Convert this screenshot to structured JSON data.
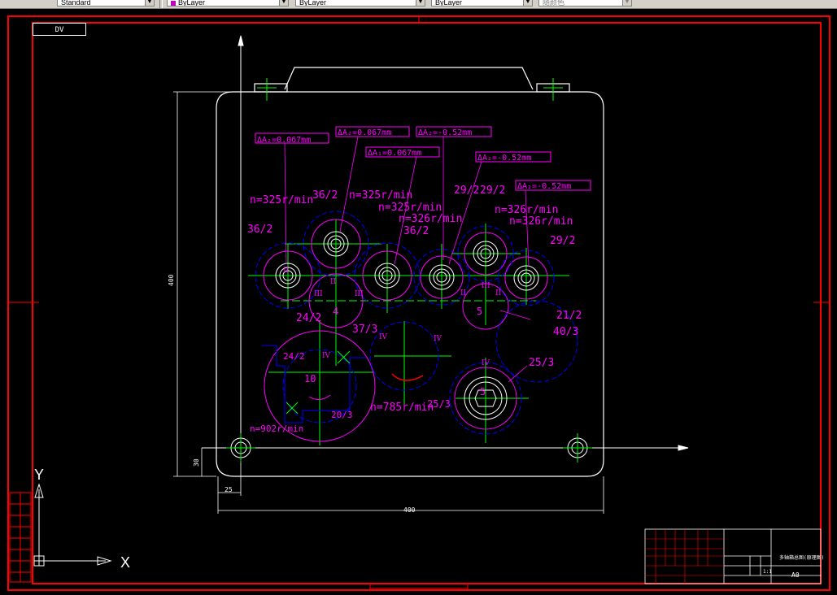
{
  "toolbar": {
    "style_combo": "Standard",
    "layer_combo": "ByLayer",
    "linetype_combo": "ByLayer",
    "lineweight_combo": "ByLayer",
    "plotstyle_combo": "随颜色"
  },
  "view_tag": "DV",
  "ucs": {
    "x_label": "X",
    "y_label": "Y"
  },
  "tolerances": [
    "ΔA₂=0.067mm",
    "ΔA₂=0.067mm",
    "ΔA₂=-0.52mm",
    "ΔA₁=0.067mm",
    "ΔA₂=-0.52mm",
    "ΔA₂=-0.52mm"
  ],
  "speeds": [
    "n=325r/min",
    "n=325r/min",
    "n=325r/min",
    "n=326r/min",
    "n=326r/min",
    "n=326r/min",
    "n=785r/min",
    "n=902r/min"
  ],
  "gear_labels": [
    "36/2",
    "36/2",
    "36/2",
    "29/2",
    "29/2",
    "29/2",
    "21/2",
    "40/3",
    "25/3",
    "24/2",
    "37/3",
    "24/2",
    "20/3",
    "25/3"
  ],
  "roman_labels": [
    "II",
    "III",
    "III",
    "II",
    "II",
    "III",
    "II",
    "IV",
    "IV",
    "IV",
    "IV"
  ],
  "numbers": [
    "4",
    "5",
    "10",
    "5"
  ],
  "dims": {
    "height": "400",
    "width": "400",
    "offset_y": "30",
    "offset_x": "25"
  },
  "title_block": {
    "sheet_size": "A0",
    "scale": "1:1",
    "drawing_name": "多轴箱总图(原理图)"
  },
  "colors": {
    "magenta": "#ff00ff",
    "green": "#00ff00",
    "blue": "#0000ff",
    "red": "#ff0000",
    "white": "#ffffff"
  }
}
